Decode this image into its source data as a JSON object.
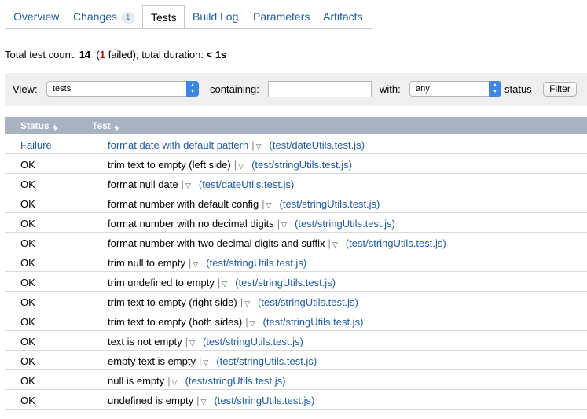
{
  "tabs": [
    {
      "label": "Overview"
    },
    {
      "label": "Changes",
      "badge": "1"
    },
    {
      "label": "Tests"
    },
    {
      "label": "Build Log"
    },
    {
      "label": "Parameters"
    },
    {
      "label": "Artifacts"
    }
  ],
  "summary": {
    "prefix": "Total test count:",
    "count": "14",
    "open_paren": "(",
    "failed_count": "1",
    "failed_suffix": "failed); total duration:",
    "duration": "< 1s"
  },
  "filter": {
    "view_label": "View:",
    "view_value": "tests",
    "containing_label": "containing:",
    "containing_value": "",
    "with_label": "with:",
    "with_value": "any",
    "status_label": "status",
    "filter_button": "Filter"
  },
  "table": {
    "columns": {
      "status": "Status",
      "test": "Test"
    },
    "rows": [
      {
        "status": "Failure",
        "name": "format date with default pattern",
        "path": "(test/dateUtils.test.js)"
      },
      {
        "status": "OK",
        "name": "trim text to empty (left side)",
        "path": "(test/stringUtils.test.js)"
      },
      {
        "status": "OK",
        "name": "format null date",
        "path": "(test/dateUtils.test.js)"
      },
      {
        "status": "OK",
        "name": "format number with default config",
        "path": "(test/stringUtils.test.js)"
      },
      {
        "status": "OK",
        "name": "format number with no decimal digits",
        "path": "(test/stringUtils.test.js)"
      },
      {
        "status": "OK",
        "name": "format number with two decimal digits and suffix",
        "path": "(test/stringUtils.test.js)"
      },
      {
        "status": "OK",
        "name": "trim null to empty",
        "path": "(test/stringUtils.test.js)"
      },
      {
        "status": "OK",
        "name": "trim undefined to empty",
        "path": "(test/stringUtils.test.js)"
      },
      {
        "status": "OK",
        "name": "trim text to empty (right side)",
        "path": "(test/stringUtils.test.js)"
      },
      {
        "status": "OK",
        "name": "trim text to empty (both sides)",
        "path": "(test/stringUtils.test.js)"
      },
      {
        "status": "OK",
        "name": "text is not empty",
        "path": "(test/stringUtils.test.js)"
      },
      {
        "status": "OK",
        "name": "empty text is empty",
        "path": "(test/stringUtils.test.js)"
      },
      {
        "status": "OK",
        "name": "null is empty",
        "path": "(test/stringUtils.test.js)"
      },
      {
        "status": "OK",
        "name": "undefined is empty",
        "path": "(test/stringUtils.test.js)"
      }
    ]
  },
  "icons": {
    "sort": "sort-icon",
    "select_arrow": "select-arrows-icon",
    "row_menu": "triangle-down-icon"
  },
  "colors": {
    "link": "#1e5aa8",
    "failed_count": "#cc0000",
    "header_bg": "#a8b2c2"
  }
}
